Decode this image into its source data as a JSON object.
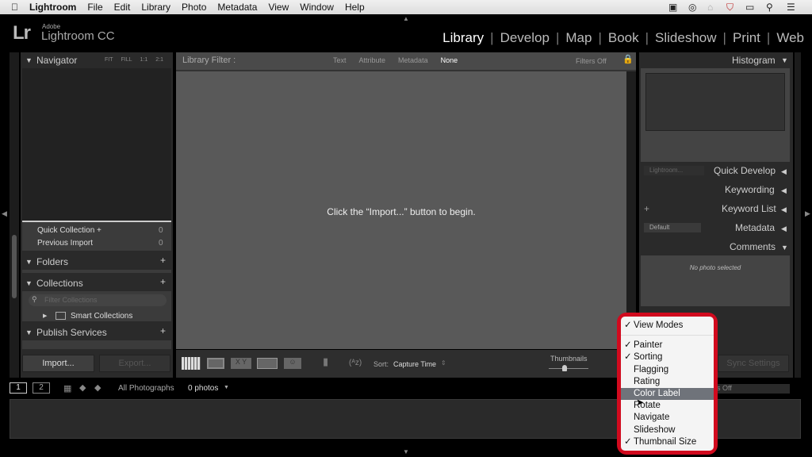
{
  "menubar": {
    "app": "Lightroom",
    "items": [
      "File",
      "Edit",
      "Library",
      "Photo",
      "Metadata",
      "View",
      "Window",
      "Help"
    ]
  },
  "logo": {
    "adobe": "Adobe",
    "lr": "Lr",
    "name": "Lightroom CC"
  },
  "modules": [
    "Library",
    "Develop",
    "Map",
    "Book",
    "Slideshow",
    "Print",
    "Web"
  ],
  "active_module": "Library",
  "navigator": {
    "title": "Navigator",
    "zoom": [
      "FIT",
      "FILL",
      "1:1",
      "2:1"
    ]
  },
  "catalog": [
    {
      "label": "Quick Collection +",
      "count": "0"
    },
    {
      "label": "Previous Import",
      "count": "0"
    }
  ],
  "folders": {
    "title": "Folders"
  },
  "collections": {
    "title": "Collections",
    "filter_placeholder": "Filter Collections",
    "smart": "Smart Collections"
  },
  "publish": {
    "title": "Publish Services"
  },
  "left_buttons": {
    "import": "Import...",
    "export": "Export..."
  },
  "filter": {
    "title": "Library Filter :",
    "tabs": [
      "Text",
      "Attribute",
      "Metadata",
      "None"
    ],
    "active": "None",
    "status": "Filters Off"
  },
  "main": {
    "message": "Click the “Import...” button to begin."
  },
  "toolbar": {
    "sort_label": "Sort:",
    "sort_value": "Capture Time",
    "thumbnails": "Thumbnails",
    "thumbnail_size": 0.4
  },
  "right": {
    "histogram": "Histogram",
    "preset": "Lightroom...",
    "quick_develop": "Quick Develop",
    "keywording": "Keywording",
    "keyword_list": "Keyword List",
    "metadata_preset": "Default",
    "metadata": "Metadata",
    "comments": "Comments",
    "no_photo": "No photo selected",
    "sync": "Sync Settings"
  },
  "filmstrip": {
    "screen1": "1",
    "screen2": "2",
    "source": "All Photographs",
    "count": "0 photos",
    "filter": "Filters Off"
  },
  "menu": {
    "items": [
      {
        "label": "View Modes",
        "checked": true
      },
      {
        "label": "Painter",
        "checked": true
      },
      {
        "label": "Sorting",
        "checked": true
      },
      {
        "label": "Flagging",
        "checked": false
      },
      {
        "label": "Rating",
        "checked": false
      },
      {
        "label": "Color Label",
        "checked": false,
        "highlighted": true
      },
      {
        "label": "Rotate",
        "checked": false
      },
      {
        "label": "Navigate",
        "checked": false
      },
      {
        "label": "Slideshow",
        "checked": false
      },
      {
        "label": "Thumbnail Size",
        "checked": true
      }
    ],
    "check": "✓"
  },
  "colors": {
    "menu_border": "#d10a1e",
    "panel": "#2a2a2a",
    "center": "#595959"
  }
}
